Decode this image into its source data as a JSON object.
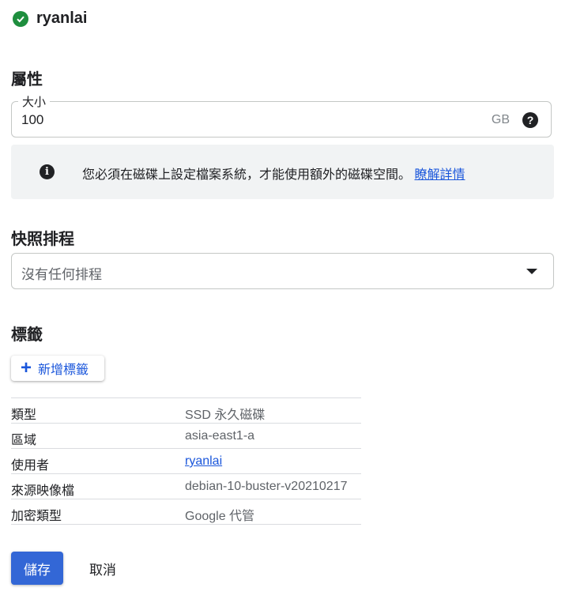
{
  "header": {
    "title": "ryanlai",
    "status_icon": "check-circle-icon",
    "status_color": "#1e8e3e"
  },
  "properties": {
    "section_title": "屬性",
    "size": {
      "label": "大小",
      "value": "100",
      "unit": "GB",
      "help_icon": "help-icon"
    },
    "info": {
      "icon": "info-icon",
      "text": "您必須在磁碟上設定檔案系統，才能使用額外的磁碟空間。",
      "link": "瞭解詳情"
    }
  },
  "snapshot": {
    "section_title": "快照排程",
    "select_value": "沒有任何排程",
    "icon": "dropdown-arrow-icon"
  },
  "labels": {
    "section_title": "標籤",
    "add_button": "新增標籤",
    "add_icon": "plus-icon"
  },
  "details": [
    {
      "key": "類型",
      "value": "SSD 永久磁碟"
    },
    {
      "key": "區域",
      "value": "asia-east1-a"
    },
    {
      "key": "使用者",
      "value": "ryanlai"
    },
    {
      "key": "來源映像檔",
      "value": "debian-10-buster-v20210217"
    },
    {
      "key": "加密類型",
      "value": "Google 代管"
    }
  ],
  "actions": {
    "save": "儲存",
    "cancel": "取消"
  },
  "colors": {
    "accent": "#1a56db",
    "primary_button": "#3367d6",
    "info_bg": "#f1f3f4"
  }
}
